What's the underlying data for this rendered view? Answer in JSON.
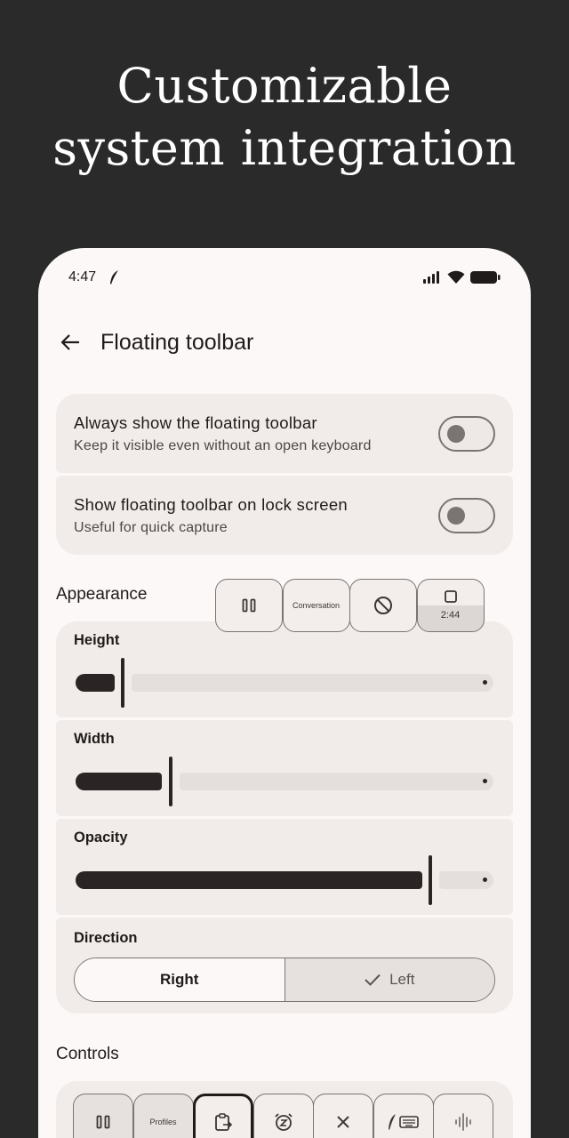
{
  "promo": {
    "line1": "Customizable",
    "line2": "system integration"
  },
  "status_bar": {
    "time": "4:47",
    "icons": [
      "feather-icon",
      "signal-icon",
      "wifi-icon",
      "battery-icon"
    ]
  },
  "app_bar": {
    "title": "Floating toolbar",
    "back_icon": "arrow-back-icon"
  },
  "settings": [
    {
      "title": "Always show the floating toolbar",
      "subtitle": "Keep it visible even without an open keyboard",
      "enabled": false
    },
    {
      "title": "Show floating toolbar on lock screen",
      "subtitle": "Useful for quick capture",
      "enabled": false
    }
  ],
  "appearance": {
    "header": "Appearance",
    "sliders": [
      {
        "label": "Height",
        "value": 0.11
      },
      {
        "label": "Width",
        "value": 0.23
      },
      {
        "label": "Opacity",
        "value": 0.86
      }
    ],
    "direction": {
      "label": "Direction",
      "options": [
        "Right",
        "Left"
      ],
      "selected": "Left"
    }
  },
  "floating_toolbar_preview": {
    "buttons": [
      {
        "icon": "pause-icon"
      },
      {
        "label": "Conversation"
      },
      {
        "icon": "block-icon"
      },
      {
        "icon": "stop-icon",
        "timer": "2:44"
      }
    ]
  },
  "controls": {
    "header": "Controls",
    "buttons": [
      {
        "icon": "pause-icon"
      },
      {
        "label": "Profiles"
      },
      {
        "icon": "clipboard-icon"
      },
      {
        "icon": "snooze-alarm-icon"
      },
      {
        "icon": "close-icon"
      },
      {
        "icon": "feather-keyboard-icon"
      },
      {
        "icon": "waveform-icon"
      }
    ]
  },
  "colors": {
    "background": "#2a2a2a",
    "surface": "#fbf8f7",
    "card": "#f1ecea",
    "accent": "#2a2424"
  }
}
